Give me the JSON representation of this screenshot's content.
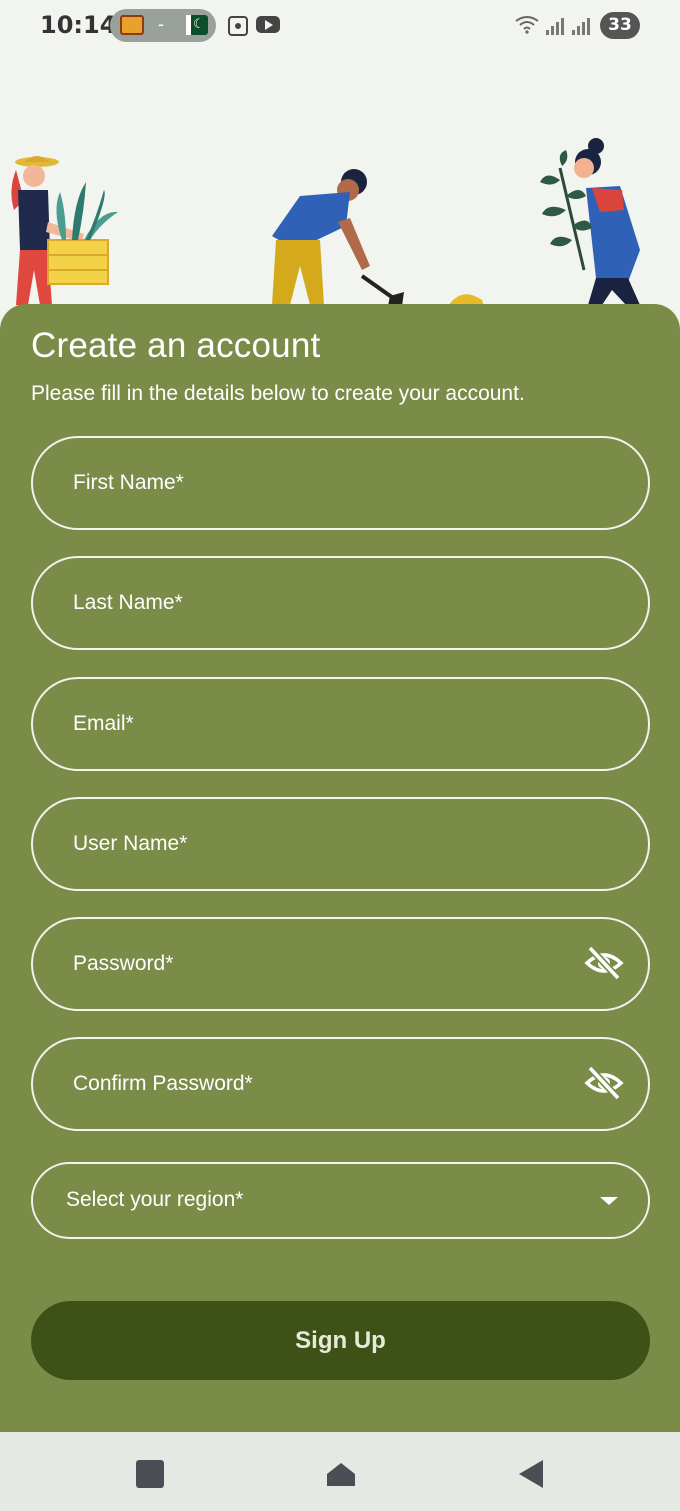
{
  "status_bar": {
    "time": "10:14",
    "pill_separator": "-",
    "battery": "33"
  },
  "form": {
    "title": "Create an account",
    "subtitle": "Please fill in the details below to create your account.",
    "fields": {
      "first_name": {
        "placeholder": "First Name*"
      },
      "last_name": {
        "placeholder": "Last Name*"
      },
      "email": {
        "placeholder": "Email*"
      },
      "user_name": {
        "placeholder": "User Name*"
      },
      "password": {
        "placeholder": "Password*"
      },
      "confirm_password": {
        "placeholder": "Confirm Password*"
      }
    },
    "region_select": {
      "label": "Select your region*"
    },
    "signup_label": "Sign Up"
  },
  "icons": {
    "password_toggle": "eye-off-icon",
    "confirm_password_toggle": "eye-off-icon",
    "region_dropdown": "caret-down-icon",
    "nav_recents": "square-icon",
    "nav_home": "home-icon",
    "nav_back": "back-triangle-icon"
  },
  "colors": {
    "panel": "#7a8c48",
    "button": "#3e5218",
    "background": "#f2f4ef",
    "nav_bar": "#e6e9e3"
  }
}
